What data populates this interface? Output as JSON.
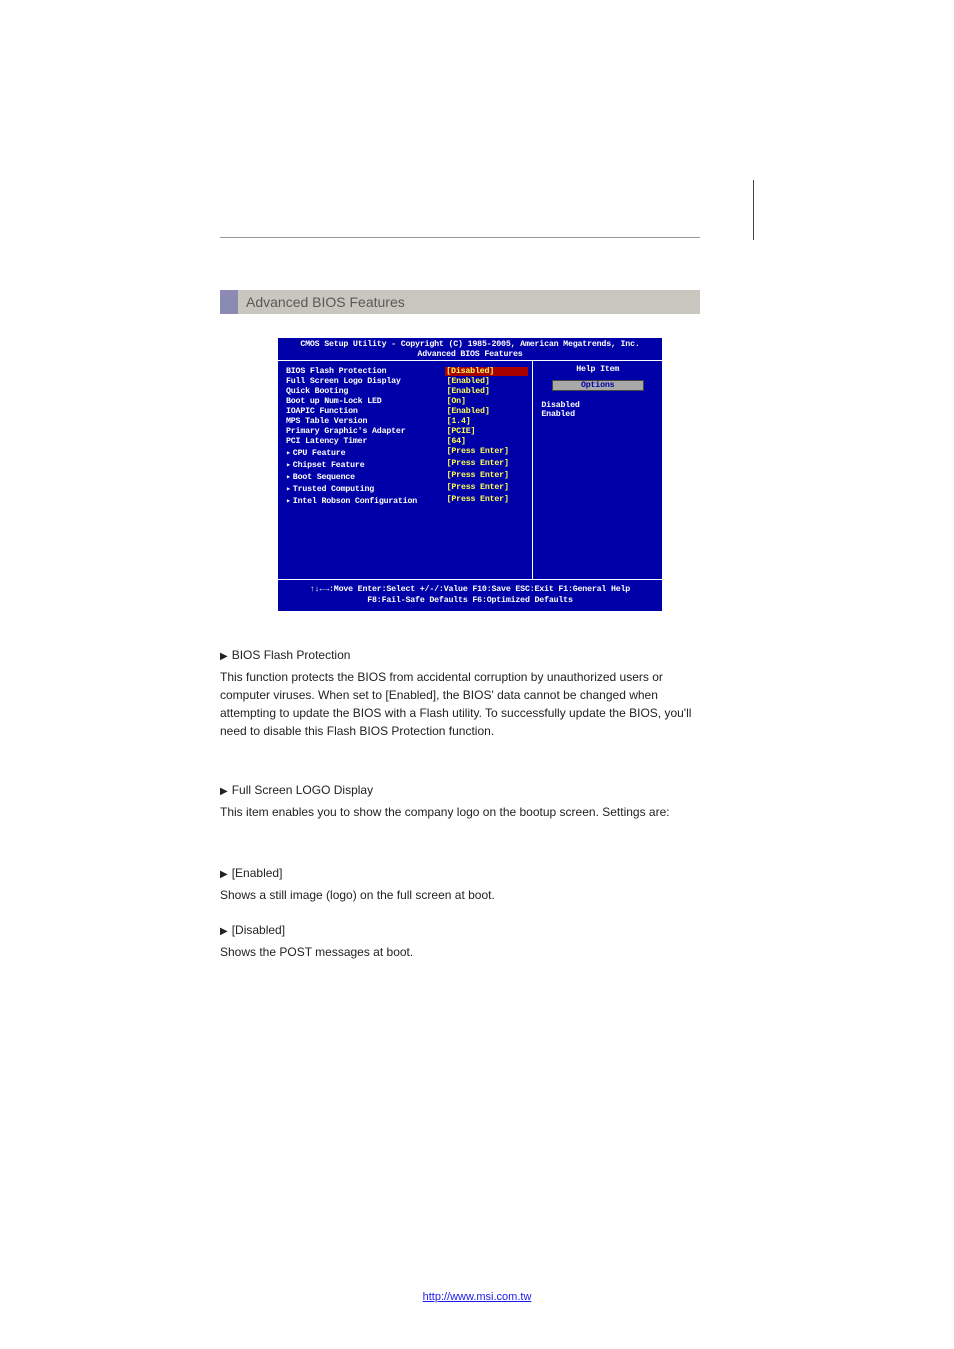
{
  "sectionTitle": "Advanced BIOS Features",
  "bios": {
    "headerLine1": "CMOS Setup Utility - Copyright (C) 1985-2005, American Megatrends, Inc.",
    "headerLine2": "Advanced BIOS Features",
    "rows": [
      {
        "label": "BIOS Flash Protection",
        "value": "[Disabled]",
        "highlight": true
      },
      {
        "label": "Full Screen Logo Display",
        "value": "[Enabled]"
      },
      {
        "label": "Quick Booting",
        "value": "[Enabled]"
      },
      {
        "label": "Boot up Num-Lock LED",
        "value": "[On]"
      },
      {
        "label": "IOAPIC Function",
        "value": "[Enabled]"
      },
      {
        "label": "MPS Table Version",
        "value": "[1.4]"
      },
      {
        "label": "Primary Graphic's Adapter",
        "value": "[PCIE]"
      },
      {
        "label": "PCI Latency Timer",
        "value": "[64]"
      },
      {
        "label": "CPU Feature",
        "value": "[Press Enter]",
        "submenu": true
      },
      {
        "label": "Chipset Feature",
        "value": "[Press Enter]",
        "submenu": true
      },
      {
        "label": "Boot Sequence",
        "value": "[Press Enter]",
        "submenu": true
      },
      {
        "label": "Trusted Computing",
        "value": "[Press Enter]",
        "submenu": true
      },
      {
        "label": "Intel Robson Configuration",
        "value": "[Press Enter]",
        "submenu": true
      }
    ],
    "help": {
      "title": "Help Item",
      "button": "Options",
      "opt1": "Disabled",
      "opt2": "Enabled"
    },
    "footer1": "↑↓←→:Move  Enter:Select  +/-/:Value  F10:Save  ESC:Exit  F1:General Help",
    "footer2": "F8:Fail-Safe Defaults    F6:Optimized Defaults"
  },
  "sections": [
    {
      "head": "BIOS Flash Protection",
      "body": "This function protects the BIOS from accidental corruption by unauthorized users or computer viruses. When set to [Enabled], the BIOS' data cannot be changed when attempting to update the BIOS with a Flash utility. To successfully update the BIOS, you'll need to disable this Flash BIOS Protection function."
    },
    {
      "head": "Full Screen LOGO Display",
      "body": "This item enables you to show the company logo on the bootup screen. Settings are:"
    },
    {
      "head": "[Enabled]",
      "body": "Shows a still image (logo) on the full screen at boot."
    },
    {
      "head": "[Disabled]",
      "body": "Shows the POST messages at boot."
    }
  ],
  "footerLink": "http://www.msi.com.tw"
}
